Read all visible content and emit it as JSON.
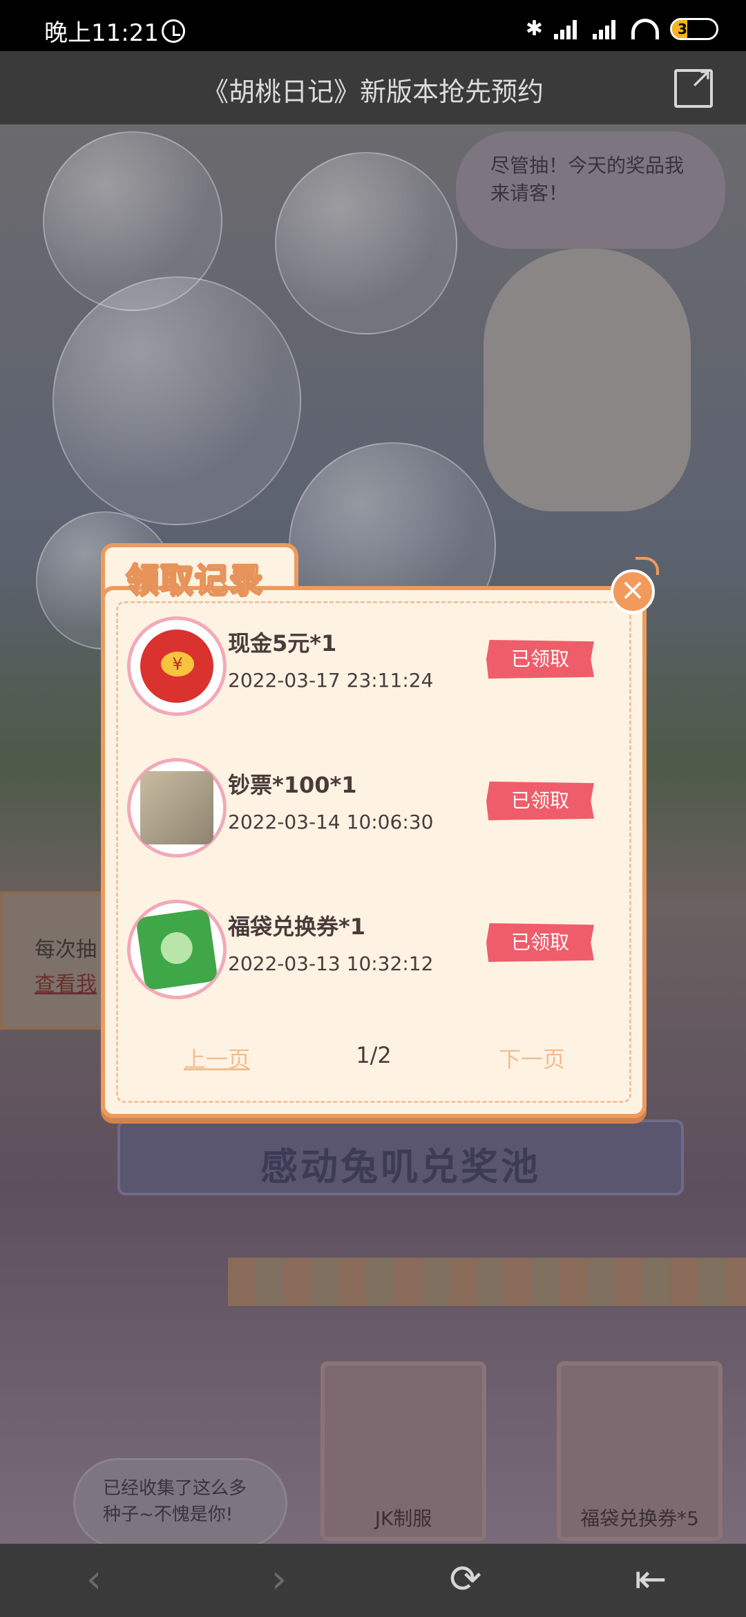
{
  "status_bar": {
    "time": "晚上11:21",
    "battery": "35",
    "battery_level": 0.35
  },
  "header": {
    "title": "《胡桃日记》新版本抢先预约"
  },
  "background": {
    "speech_bubble": "尽管抽！今天的奖品我来请客！",
    "info_text": "每次抽",
    "info_link": "查看我",
    "pool_title": "感动兔叽兑奖池",
    "prizes": [
      {
        "label": "JK制服"
      },
      {
        "label": "福袋兑换券*5"
      }
    ],
    "seed_bubble": "已经收集了这么多种子~不愧是你!"
  },
  "modal": {
    "title": "领取记录",
    "records": [
      {
        "name": "现金5元*1",
        "time": "2022-03-17 23:11:24",
        "status": "已领取",
        "icon": "red-packet-icon"
      },
      {
        "name": "钞票*100*1",
        "time": "2022-03-14 10:06:30",
        "status": "已领取",
        "icon": "cash-stack-icon"
      },
      {
        "name": "福袋兑换券*1",
        "time": "2022-03-13 10:32:12",
        "status": "已领取",
        "icon": "lucky-bag-coupon-icon"
      }
    ],
    "pager": {
      "prev": "上一页",
      "page": "1/2",
      "next": "下一页"
    }
  },
  "colors": {
    "accent": "#ec9b5d",
    "badge": "#ef5d6a",
    "modal_bg": "#fef3e3"
  }
}
